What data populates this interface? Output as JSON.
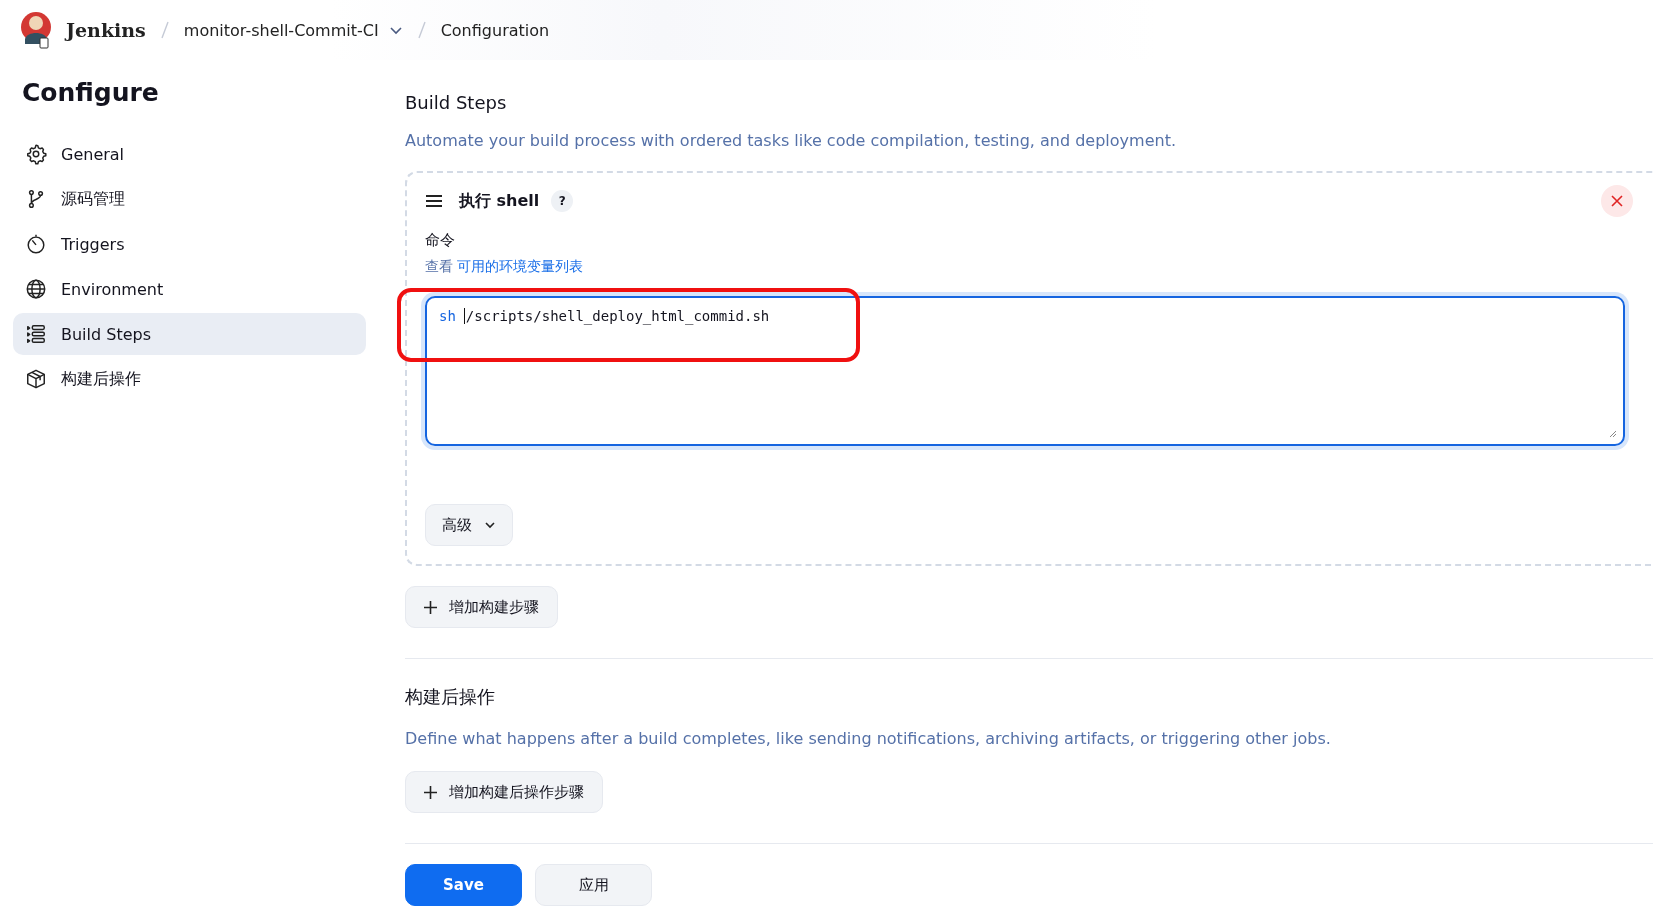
{
  "breadcrumb": {
    "brand": "Jenkins",
    "items": [
      {
        "label": "monitor-shell-Commit-CI",
        "has_menu": true
      },
      {
        "label": "Configuration",
        "has_menu": false
      }
    ]
  },
  "sidebar": {
    "title": "Configure",
    "items": [
      {
        "label": "General",
        "selected": false
      },
      {
        "label": "源码管理",
        "selected": false
      },
      {
        "label": "Triggers",
        "selected": false
      },
      {
        "label": "Environment",
        "selected": false
      },
      {
        "label": "Build Steps",
        "selected": true
      },
      {
        "label": "构建后操作",
        "selected": false
      }
    ]
  },
  "build_steps": {
    "title": "Build Steps",
    "description": "Automate your build process with ordered tasks like code compilation, testing, and deployment.",
    "step": {
      "title": "执行 shell",
      "help": "?",
      "field_label": "命令",
      "hint_prefix": "查看",
      "hint_link": "可用的环境变量列表",
      "focused": true,
      "command": [
        {
          "text": "sh",
          "kind": "keyword"
        },
        {
          "text": "/scripts/shell_deploy_html_commid.sh",
          "kind": "plain"
        }
      ],
      "advanced": "高级"
    },
    "add_button": "增加构建步骤"
  },
  "post_build": {
    "title": "构建后操作",
    "description": "Define what happens after a build completes, like sending notifications, archiving artifacts, or triggering other jobs.",
    "add_button": "增加构建后操作步骤"
  },
  "buttons": [
    {
      "label": "Save",
      "kind": "primary"
    },
    {
      "label": "应用",
      "kind": "secondary"
    }
  ]
}
